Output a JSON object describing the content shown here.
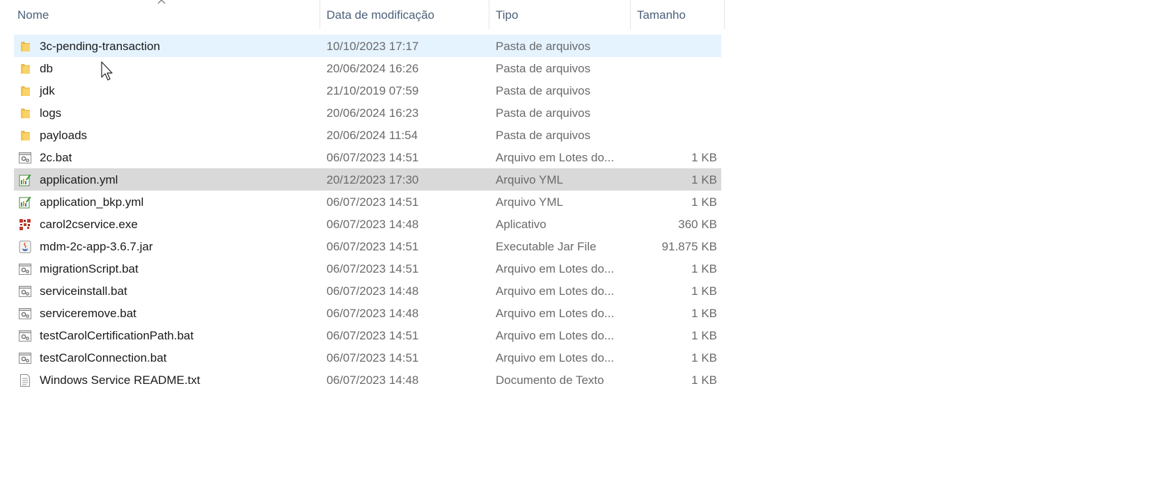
{
  "columns": {
    "name": "Nome",
    "date": "Data de modificação",
    "type": "Tipo",
    "size": "Tamanho"
  },
  "sort": {
    "column": "name",
    "icon": "sort-ascending-icon"
  },
  "rows": [
    {
      "name": "3c-pending-transaction",
      "date": "10/10/2023 17:17",
      "type": "Pasta de arquivos",
      "size": "",
      "icon": "folder-icon",
      "state": "hover"
    },
    {
      "name": "db",
      "date": "20/06/2024 16:26",
      "type": "Pasta de arquivos",
      "size": "",
      "icon": "folder-icon",
      "state": ""
    },
    {
      "name": "jdk",
      "date": "21/10/2019 07:59",
      "type": "Pasta de arquivos",
      "size": "",
      "icon": "folder-icon",
      "state": ""
    },
    {
      "name": "logs",
      "date": "20/06/2024 16:23",
      "type": "Pasta de arquivos",
      "size": "",
      "icon": "folder-icon",
      "state": ""
    },
    {
      "name": "payloads",
      "date": "20/06/2024 11:54",
      "type": "Pasta de arquivos",
      "size": "",
      "icon": "folder-icon",
      "state": ""
    },
    {
      "name": "2c.bat",
      "date": "06/07/2023 14:51",
      "type": "Arquivo em Lotes do...",
      "size": "1 KB",
      "icon": "batch-file-icon",
      "state": ""
    },
    {
      "name": "application.yml",
      "date": "20/12/2023 17:30",
      "type": "Arquivo YML",
      "size": "1 KB",
      "icon": "yml-file-icon",
      "state": "selected"
    },
    {
      "name": "application_bkp.yml",
      "date": "06/07/2023 14:51",
      "type": "Arquivo YML",
      "size": "1 KB",
      "icon": "yml-file-icon",
      "state": ""
    },
    {
      "name": "carol2cservice.exe",
      "date": "06/07/2023 14:48",
      "type": "Aplicativo",
      "size": "360 KB",
      "icon": "exe-file-icon",
      "state": ""
    },
    {
      "name": "mdm-2c-app-3.6.7.jar",
      "date": "06/07/2023 14:51",
      "type": "Executable Jar File",
      "size": "91.875 KB",
      "icon": "jar-file-icon",
      "state": ""
    },
    {
      "name": "migrationScript.bat",
      "date": "06/07/2023 14:51",
      "type": "Arquivo em Lotes do...",
      "size": "1 KB",
      "icon": "batch-file-icon",
      "state": ""
    },
    {
      "name": "serviceinstall.bat",
      "date": "06/07/2023 14:48",
      "type": "Arquivo em Lotes do...",
      "size": "1 KB",
      "icon": "batch-file-icon",
      "state": ""
    },
    {
      "name": "serviceremove.bat",
      "date": "06/07/2023 14:48",
      "type": "Arquivo em Lotes do...",
      "size": "1 KB",
      "icon": "batch-file-icon",
      "state": ""
    },
    {
      "name": "testCarolCertificationPath.bat",
      "date": "06/07/2023 14:51",
      "type": "Arquivo em Lotes do...",
      "size": "1 KB",
      "icon": "batch-file-icon",
      "state": ""
    },
    {
      "name": "testCarolConnection.bat",
      "date": "06/07/2023 14:51",
      "type": "Arquivo em Lotes do...",
      "size": "1 KB",
      "icon": "batch-file-icon",
      "state": ""
    },
    {
      "name": "Windows Service README.txt",
      "date": "06/07/2023 14:48",
      "type": "Documento de Texto",
      "size": "1 KB",
      "icon": "text-file-icon",
      "state": ""
    }
  ],
  "colors": {
    "hover_row": "#e5f3ff",
    "selected_row": "#d9d9d9",
    "header_text": "#4c607a",
    "secondary_text": "#6a6a6a"
  }
}
